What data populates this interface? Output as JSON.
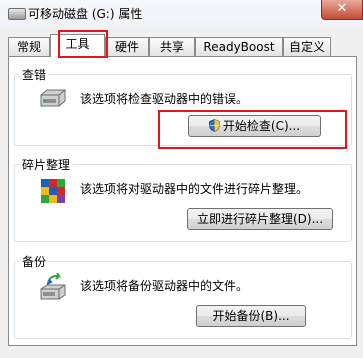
{
  "window": {
    "title": "可移动磁盘 (G:) 属性",
    "close_label": "✕"
  },
  "tabs": [
    {
      "label": "常规",
      "active": false
    },
    {
      "label": "工具",
      "active": true
    },
    {
      "label": "硬件",
      "active": false
    },
    {
      "label": "共享",
      "active": false
    },
    {
      "label": "ReadyBoost",
      "active": false
    },
    {
      "label": "自定义",
      "active": false
    }
  ],
  "error_check": {
    "title": "查错",
    "description": "该选项将检查驱动器中的错误。",
    "button_label": "开始检查(C)..."
  },
  "defrag": {
    "title": "碎片整理",
    "description": "该选项将对驱动器中的文件进行碎片整理。",
    "button_label": "立即进行碎片整理(D)..."
  },
  "backup": {
    "title": "备份",
    "description": "该选项将备份驱动器中的文件。",
    "button_label": "开始备份(B)..."
  },
  "colors": {
    "highlight": "#e4151b",
    "window_bg": "#f0f0f0"
  },
  "icons": [
    "drive-icon",
    "shield-icon",
    "defrag-icon",
    "backup-icon",
    "close-icon"
  ]
}
